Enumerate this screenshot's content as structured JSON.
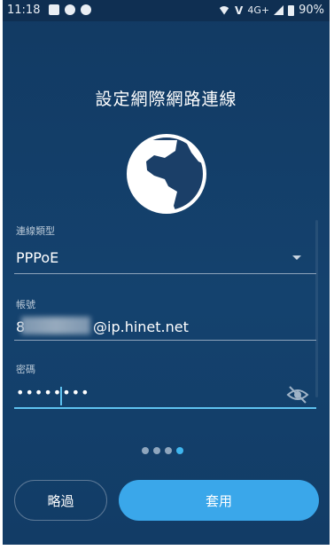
{
  "statusbar": {
    "time": "11:18",
    "network": "4G+",
    "volte": "VoLTE",
    "battery": "90%"
  },
  "page": {
    "title": "設定網際網路連線"
  },
  "icons": {
    "globe": "globe-icon",
    "eye": "eye-off-icon",
    "dropdown": "chevron-down-icon"
  },
  "form": {
    "connection_type": {
      "label": "連線類型",
      "value": "PPPoE"
    },
    "account": {
      "label": "帳號",
      "value_visible": "@ip.hinet.net"
    },
    "password": {
      "label": "密碼",
      "value": "••••••••"
    }
  },
  "pager": {
    "total": 4,
    "current": 4
  },
  "buttons": {
    "skip": "略過",
    "apply": "套用"
  },
  "colors": {
    "background": "#14426e",
    "accent": "#3aa7ea",
    "active_line": "#5ec2f0"
  }
}
